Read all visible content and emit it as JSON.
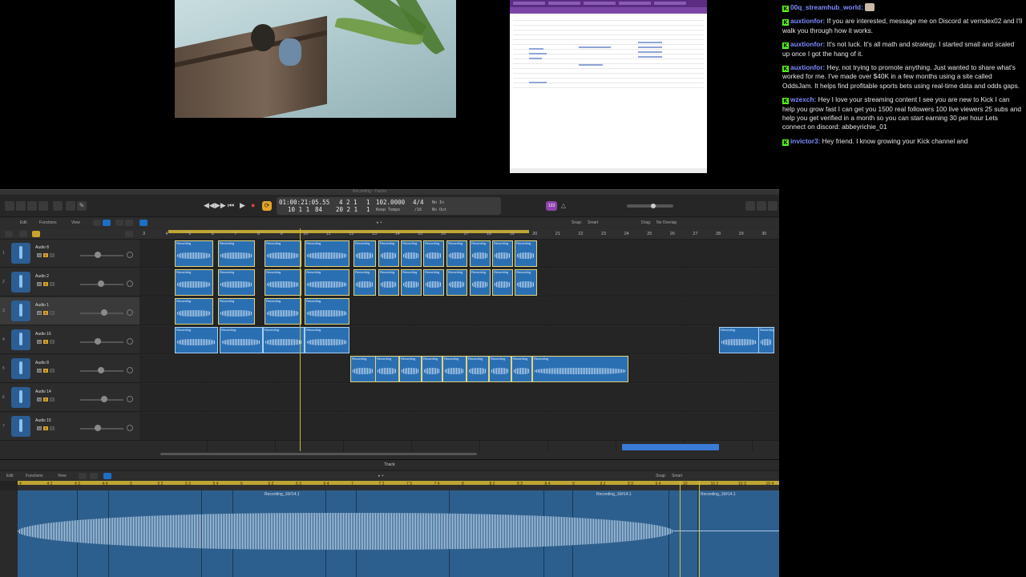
{
  "chat": {
    "messages": [
      {
        "user": "00q_streamhub_world:",
        "text": ""
      },
      {
        "user": "auxtionfor:",
        "text": "If you are interested, message me on Discord at verndex02 and I'll walk you through how it works."
      },
      {
        "user": "auxtionfor:",
        "text": "It's not luck. It's all math and strategy. I started small and scaled up once I got the hang of it."
      },
      {
        "user": "auxtionfor:",
        "text": "Hey, not trying to promote anything. Just wanted to share what's worked for me. I've made over $40K in a few months using a site called OddsJam. It helps find profitable sports bets using real-time data and odds gaps."
      },
      {
        "user": "wzexch:",
        "text": "Hey I love your streaming content I see you are new to Kick I can help you grow fast I can get you 1500 real followers 100 live viewers 25 subs and help you get verified in a month so you can start earning 30 per hour Lets connect on discord: abbeyrichie_01"
      },
      {
        "user": "invictor3:",
        "text": "Hey friend. I know growing your Kick channel and"
      }
    ],
    "badge_glyph": "K",
    "badge_color": "#53fc18",
    "username_color": "#7f8cff"
  },
  "daw": {
    "window_title": "Recording - Tracks",
    "lcd": {
      "position": "01:00:21:05.55",
      "bars": "4  2  1",
      "bar_sub": "1",
      "bars2": "10  1  1",
      "beats2": "84",
      "tempo": "102.0000",
      "tempo_label": "Keep Tempo",
      "signature": "4/4",
      "division": "/16",
      "in": "No In",
      "out": "No Out",
      "bar_lo": "20  2  1",
      "bar_lo_sub": "1"
    },
    "toolbar": {
      "edit": "Edit",
      "functions": "Functions",
      "view": "View",
      "snap_label": "Snap:",
      "snap_value": "Smart",
      "drag_label": "Drag:",
      "drag_value": "No Overlap"
    },
    "ruler_numbers": [
      "3",
      "4",
      "5",
      "6",
      "7",
      "8",
      "9",
      "10",
      "11",
      "12",
      "13",
      "14",
      "15",
      "16",
      "17",
      "18",
      "19",
      "20",
      "21",
      "22",
      "23",
      "24",
      "25",
      "26",
      "27",
      "28",
      "29",
      "30"
    ],
    "tracks": [
      {
        "num": "1",
        "name": "Audio 8"
      },
      {
        "num": "2",
        "name": "Audio 2"
      },
      {
        "num": "3",
        "name": "Audio 1"
      },
      {
        "num": "4",
        "name": "Audio 16"
      },
      {
        "num": "5",
        "name": "Audio 8"
      },
      {
        "num": "6",
        "name": "Audio 14"
      },
      {
        "num": "7",
        "name": "Audio 15"
      }
    ],
    "region_label": "Recording",
    "editor": {
      "title": "Track",
      "edit": "Edit",
      "functions": "Functions",
      "view": "View",
      "snap_label": "Snap:",
      "snap_value": "Smart",
      "ruler": [
        "4",
        "4 2",
        "4 3",
        "4 4",
        "5",
        "5 2",
        "5 3",
        "5 4",
        "6",
        "6 2",
        "6 3",
        "6 4",
        "7",
        "7 2",
        "7 3",
        "7 4",
        "8",
        "8 2",
        "8 3",
        "8 4",
        "9",
        "9 2",
        "9 3",
        "9 4",
        "10",
        "10 2",
        "10 3",
        "10 4"
      ],
      "region_labels": [
        "Recording_16#14.1",
        "Recording_16#14.1",
        "Recording_16#14.1"
      ]
    },
    "accent_yellow": "#bfa633",
    "region_blue": "#2b6fb3"
  }
}
